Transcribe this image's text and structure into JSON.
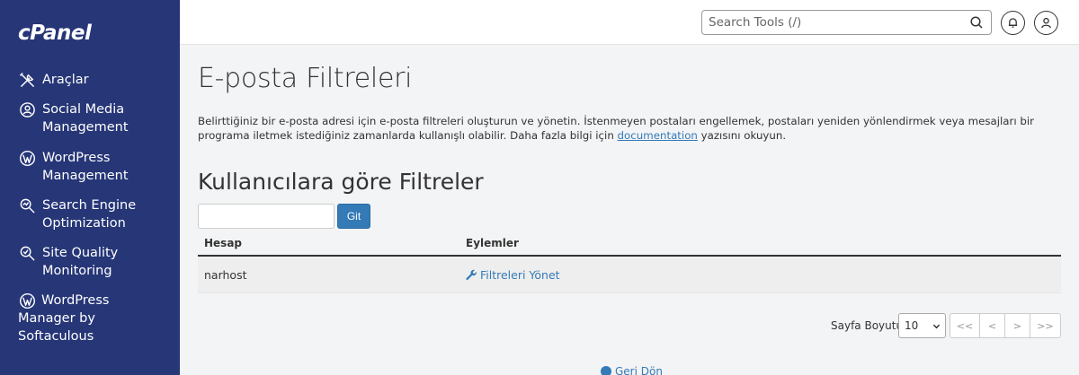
{
  "brand": {
    "logo_text": "cPanel"
  },
  "sidebar": {
    "items": [
      {
        "label": "Araçlar",
        "icon": "tools-icon"
      },
      {
        "label": "Social Media Management",
        "icon": "social-media-icon"
      },
      {
        "label": "WordPress Management",
        "icon": "wordpress-icon"
      },
      {
        "label": "Search Engine Optimization",
        "icon": "seo-icon"
      },
      {
        "label": "Site Quality Monitoring",
        "icon": "site-quality-icon"
      },
      {
        "label": "WordPress Manager by Softaculous",
        "icon": "wordpress-icon"
      }
    ]
  },
  "header": {
    "search_placeholder": "Search Tools (/)",
    "icons": [
      "search-icon",
      "bell-icon",
      "user-icon"
    ]
  },
  "main": {
    "title": "E-posta Filtreleri",
    "description_before": "Belirttiğiniz bir e-posta adresi için e-posta filtreleri oluşturun ve yönetin. İstenmeyen postaları engellemek, postaları yeniden yönlendirmek veya mesajları bir programa iletmek istediğiniz zamanlarda kullanışlı olabilir. Daha fazla bilgi için ",
    "description_link": "documentation",
    "description_after": " yazısını okuyun.",
    "section_title": "Kullanıcılara göre Filtreler",
    "filter_input_value": "",
    "go_button": "Git",
    "table": {
      "headers": [
        "Hesap",
        "Eylemler"
      ],
      "rows": [
        {
          "account": "narhost",
          "action": "Filtreleri Yönet"
        }
      ]
    },
    "pagination": {
      "label": "Sayfa Boyutu",
      "page_size": "10",
      "first": "<<",
      "prev": "<",
      "next": ">",
      "last": ">>"
    },
    "back_link": "Geri Dön"
  },
  "colors": {
    "sidebar_bg": "#263677",
    "accent": "#337ab7",
    "background": "#f3f4f6"
  }
}
